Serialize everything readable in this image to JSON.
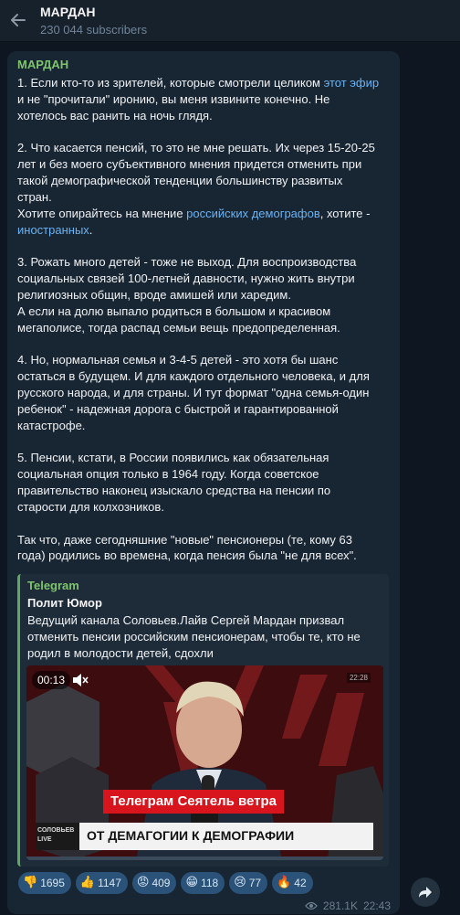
{
  "header": {
    "title": "МАРДАН",
    "subscribers": "230 044 subscribers"
  },
  "message": {
    "sender": "МАРДАН",
    "paragraphs": {
      "p1_a": "1. Если кто-то из зрителей, которые смотрели целиком ",
      "p1_link": "этот эфир",
      "p1_b": "\nи не \"прочитали\" иронию, вы меня извините конечно. Не\nхотелось вас ранить на ночь глядя.\n\n2. Что касается пенсий, то это не мне решать. Их через 15-20-25\nлет и без моего субъективного мнения придется отменить при\nтакой демографической тенденции большинству развитых\nстран.\nХотите опирайтесь на мнение ",
      "p2_link1": "российских демографов",
      "p2_mid": ", хотите -\n",
      "p2_link2": "иностранных",
      "rest": ".\n\n3. Рожать много детей - тоже не выход. Для воспроизводства\nсоциальных связей 100-летней давности, нужно жить внутри\nрелигиозных общин, вроде амишей или харедим.\nА если на долю выпало родиться в большом и красивом\nмегаполисе, тогда распад семьи вещь предопределенная.\n\n4. Но, нормальная семья и 3-4-5 детей - это хотя бы шанс\nостаться в будущем. И для каждого отдельного человека, и для\nрусского народа, и для страны. И тут формат \"одна семья-один\nребенок\" - надежная дорога с быстрой и гарантированной\nкатастрофе.\n\n5. Пенсии, кстати, в России появились как обязательная\nсоциальная опция только в 1964 году. Когда советское\nправительство наконец изыскало средства на пенсии по\nстарости для колхозников.\n\nТак что, даже сегодняшние \"новые\" пенсионеры (те, кому 63\nгода) родились во времена, когда пенсия была \"не для всех\"."
    }
  },
  "forward": {
    "source": "Telegram",
    "author": "Полит Юмор",
    "text": "Ведущий  канала Соловьев.Лайв Сергей Мардан призвал отменить пенсии российским пенсионерам, чтобы те, кто не родил в молодости детей, сдохли",
    "video": {
      "time": "00:13",
      "corner": "22:28",
      "caption": "Телеграм Сеятель ветра",
      "logo": "СОЛОВЬЕВ LIVE",
      "lower_title": "ОТ ДЕМАГОГИИ К ДЕМОГРАФИИ"
    }
  },
  "reactions": [
    {
      "icon": "thumbs-down-icon",
      "emoji": "👎",
      "count": "1695"
    },
    {
      "icon": "thumbs-up-icon",
      "emoji": "👍",
      "count": "1147"
    },
    {
      "icon": "angry-face-icon",
      "emoji": "😡",
      "count": "409"
    },
    {
      "icon": "grin-face-icon",
      "emoji": "😁",
      "count": "118"
    },
    {
      "icon": "crying-face-icon",
      "emoji": "😢",
      "count": "77"
    },
    {
      "icon": "fire-icon",
      "emoji": "🔥",
      "count": "42"
    }
  ],
  "meta": {
    "views": "281.1K",
    "time": "22:43"
  },
  "colors": {
    "background": "#0e1621",
    "bubble": "#182533",
    "accent_green": "#7ec46c",
    "link": "#6ab3f3",
    "reaction_bg": "#2b5278"
  }
}
